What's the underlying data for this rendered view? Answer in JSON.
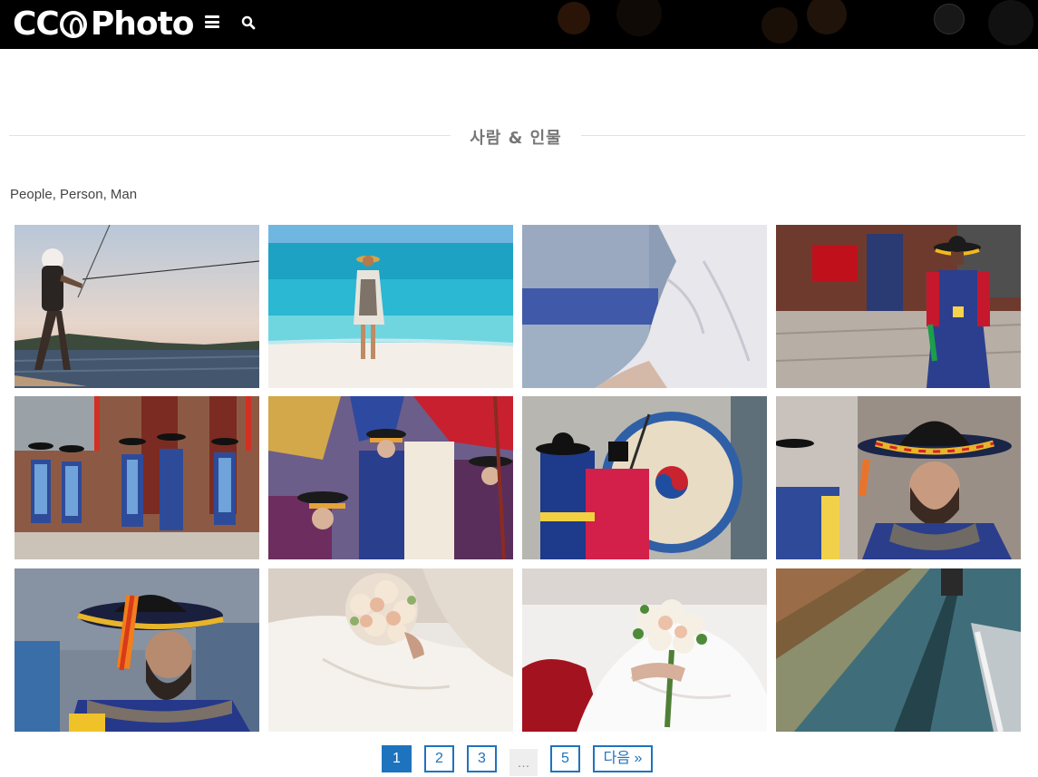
{
  "header": {
    "logo_text": "CC",
    "logo_word": "Photo",
    "menu_icon": "hamburger-menu-icon",
    "search_icon": "search-icon"
  },
  "category": {
    "title": "사람 & 인물",
    "tags": "People, Person, Man"
  },
  "photos": [
    {
      "subject": "person standing on boat at sunset"
    },
    {
      "subject": "woman in hat at tropical beach"
    },
    {
      "subject": "close-up of white shirt sleeve"
    },
    {
      "subject": "korean royal guard in traditional uniform"
    },
    {
      "subject": "royal guards lined up at palace gate"
    },
    {
      "subject": "royal guard ceremony crowd with flags"
    },
    {
      "subject": "traditional drum with taegeuk symbol"
    },
    {
      "subject": "guard with fake beard and hat"
    },
    {
      "subject": "guard hat with red tassel close-up"
    },
    {
      "subject": "bride holding bouquet"
    },
    {
      "subject": "bride with bouquet and red chair"
    },
    {
      "subject": "path with long shadow"
    }
  ],
  "pagination": {
    "pages": [
      "1",
      "2",
      "3",
      "…",
      "5"
    ],
    "current": "1",
    "next_label": "다음 »"
  },
  "colors": {
    "accent": "#1e73be",
    "header_bg": "#000000",
    "heading_text": "#777777"
  }
}
